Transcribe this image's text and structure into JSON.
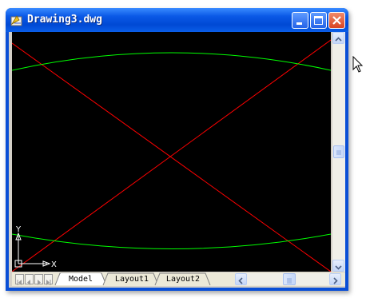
{
  "window": {
    "title": "Drawing3.dwg",
    "buttons": [
      "minimize",
      "maximize",
      "close"
    ]
  },
  "icons": {
    "app": "autocad-drawing-icon",
    "minimize": "minimize-icon",
    "maximize": "maximize-icon",
    "close": "close-icon",
    "scroll_up": "arrow-up-icon",
    "scroll_down": "arrow-down-icon",
    "scroll_left": "arrow-left-icon",
    "scroll_right": "arrow-right-icon",
    "ucs": "ucs-axis-icon",
    "cursor": "mouse-pointer-icon"
  },
  "canvas": {
    "background": "#000000",
    "ucs": {
      "x_label": "X",
      "y_label": "Y"
    },
    "colors": {
      "lines": "#ff0000",
      "arcs": "#00ff00",
      "ucs": "#ffffff"
    }
  },
  "layout_tabs": [
    {
      "label": "Model",
      "active": true
    },
    {
      "label": "Layout1",
      "active": false
    },
    {
      "label": "Layout2",
      "active": false
    }
  ],
  "colors": {
    "titlebar": "#0a58e6",
    "frame": "#d4d0c8",
    "close_button": "#d94421"
  }
}
